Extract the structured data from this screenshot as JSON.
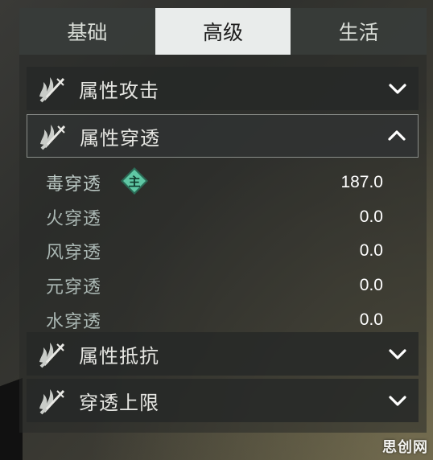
{
  "tabs": [
    {
      "label": "基础",
      "active": false
    },
    {
      "label": "高级",
      "active": true
    },
    {
      "label": "生活",
      "active": false
    }
  ],
  "sections": [
    {
      "label": "属性攻击",
      "expanded": false,
      "icon": "sword-flame-icon",
      "chevron": "chevron-down-icon"
    },
    {
      "label": "属性穿透",
      "expanded": true,
      "icon": "sword-flame-icon",
      "chevron": "chevron-up-icon"
    },
    {
      "label": "属性抵抗",
      "expanded": false,
      "icon": "sword-flame-icon",
      "chevron": "chevron-down-icon"
    },
    {
      "label": "穿透上限",
      "expanded": false,
      "icon": "sword-flame-icon",
      "chevron": "chevron-down-icon"
    }
  ],
  "penetration_stats": [
    {
      "name": "毒穿透",
      "value": "187.0",
      "badge": "主"
    },
    {
      "name": "火穿透",
      "value": "0.0"
    },
    {
      "name": "风穿透",
      "value": "0.0"
    },
    {
      "name": "元穿透",
      "value": "0.0"
    },
    {
      "name": "水穿透",
      "value": "0.0"
    }
  ],
  "watermark": "思创网",
  "colors": {
    "active_tab": "#e9eceb",
    "badge": "#5fc7a4",
    "stat_name": "#b9c6c2",
    "value": "#ffffff"
  }
}
